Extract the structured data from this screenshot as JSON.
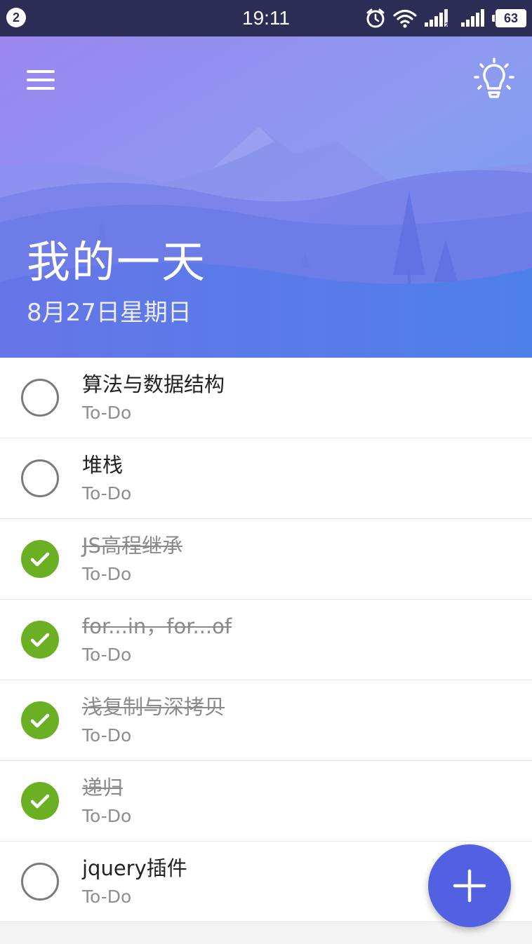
{
  "status_bar": {
    "notification_count": "2",
    "time": "19:11",
    "battery_level": "63",
    "icons": [
      "alarm-icon",
      "wifi-icon",
      "signal-sim1-icon",
      "signal-sim2-icon",
      "battery-icon"
    ]
  },
  "header": {
    "title": "我的一天",
    "date": "8月27日星期日",
    "menu_icon": "hamburger-menu-icon",
    "suggestions_icon": "lightbulb-icon",
    "gradient": [
      "#9a86ee",
      "#4f7be8"
    ]
  },
  "tasks": [
    {
      "title": "算法与数据结构",
      "list": "To-Do",
      "completed": false
    },
    {
      "title": "堆栈",
      "list": "To-Do",
      "completed": false
    },
    {
      "title": "JS高程继承",
      "list": "To-Do",
      "completed": true
    },
    {
      "title": "for...in，for...of",
      "list": "To-Do",
      "completed": true
    },
    {
      "title": "浅复制与深拷贝",
      "list": "To-Do",
      "completed": true
    },
    {
      "title": "递归",
      "list": "To-Do",
      "completed": true
    },
    {
      "title": "jquery插件",
      "list": "To-Do",
      "completed": false
    }
  ],
  "fab": {
    "icon": "plus-icon"
  },
  "colors": {
    "status_bar": "#2b2d55",
    "completed_check": "#6bb023",
    "fab": "#5161e2"
  }
}
